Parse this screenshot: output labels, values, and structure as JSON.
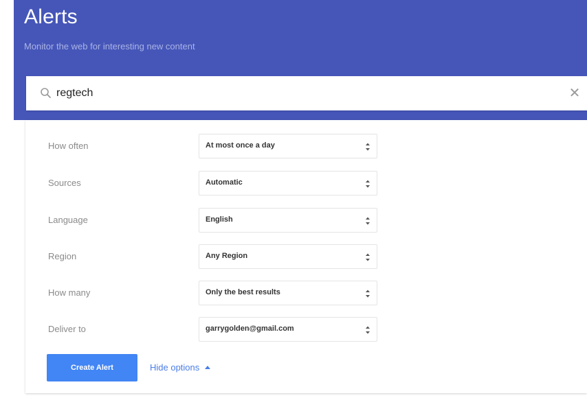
{
  "header": {
    "title": "Alerts",
    "subtitle": "Monitor the web for interesting new content",
    "background_color": "#4656b8"
  },
  "search": {
    "value": "regtech",
    "icon": "search-icon",
    "clear_icon": "close-icon",
    "clear_glyph": "✕"
  },
  "options": [
    {
      "id": "how-often",
      "label": "How often",
      "value": "At most once a day"
    },
    {
      "id": "sources",
      "label": "Sources",
      "value": "Automatic"
    },
    {
      "id": "language",
      "label": "Language",
      "value": "English"
    },
    {
      "id": "region",
      "label": "Region",
      "value": "Any Region"
    },
    {
      "id": "how-many",
      "label": "How many",
      "value": "Only the best results"
    },
    {
      "id": "deliver-to",
      "label": "Deliver to",
      "value": "garrygolden@gmail.com"
    }
  ],
  "actions": {
    "create_label": "Create Alert",
    "hide_options_label": "Hide options",
    "accent_color": "#4285f4"
  }
}
